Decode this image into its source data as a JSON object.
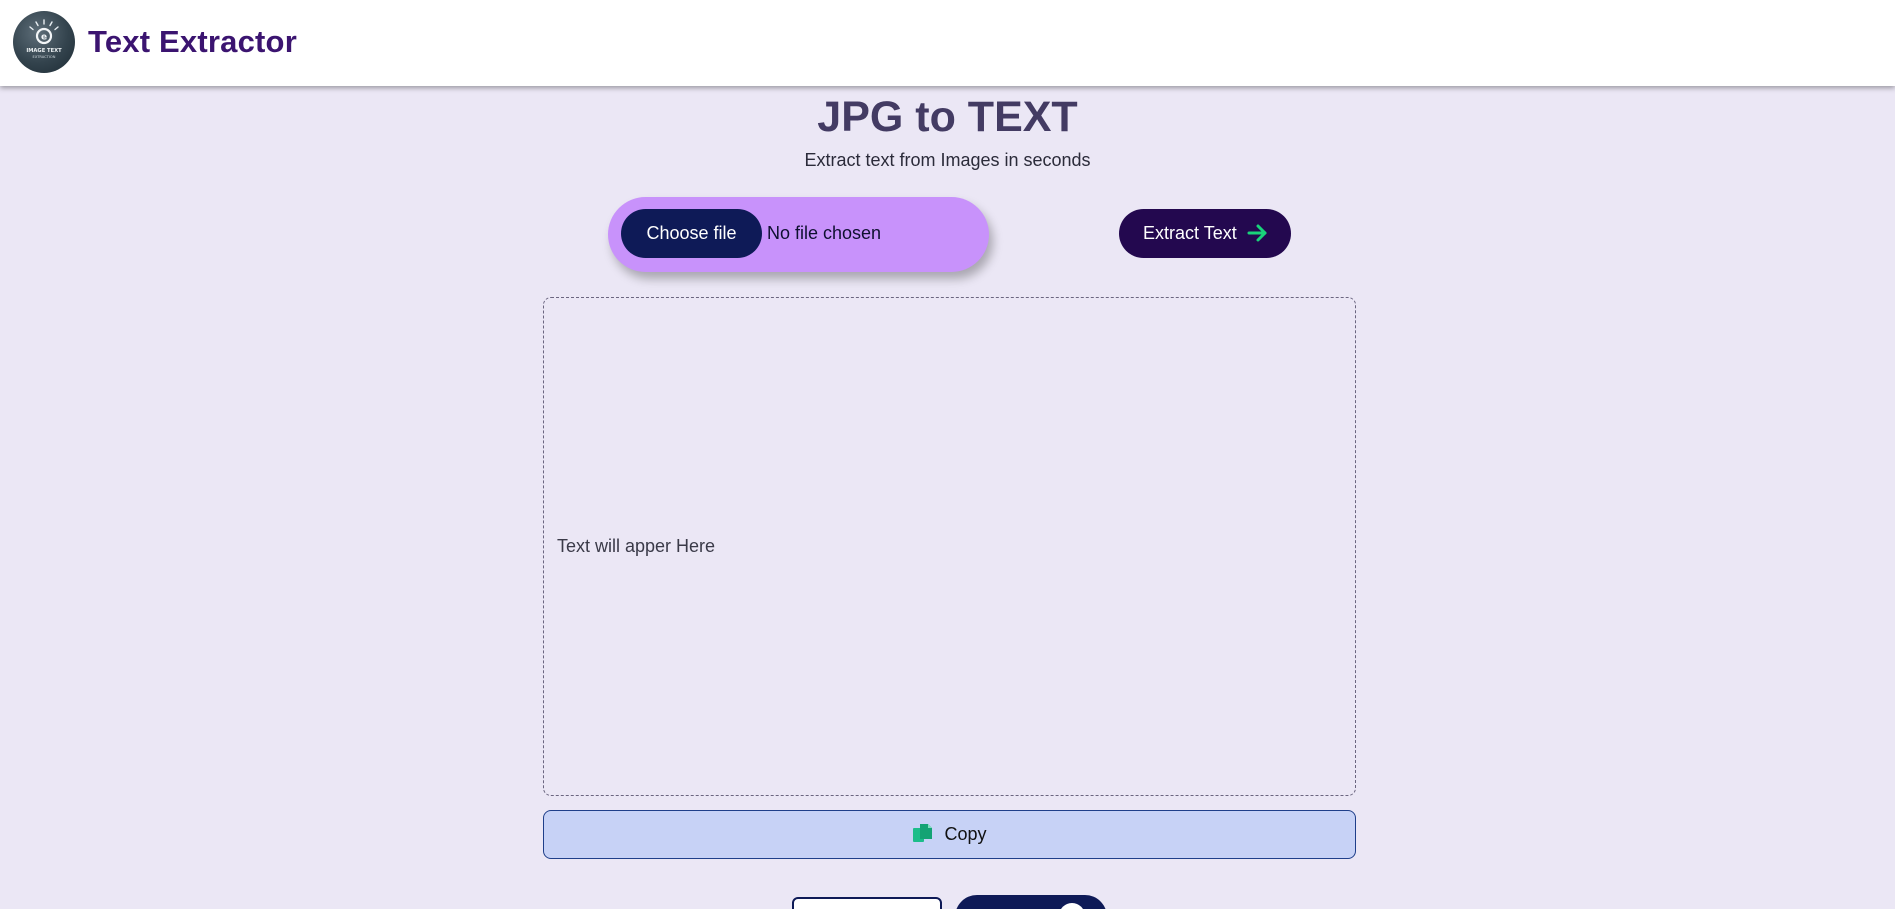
{
  "header": {
    "brand": "Text Extractor",
    "logo_icon": "image-text-extraction-logo"
  },
  "main": {
    "title": "JPG to TEXT",
    "subtitle": "Extract text from Images in seconds",
    "file_input": {
      "button_label": "Choose file",
      "status": "No file chosen"
    },
    "extract_button": {
      "label": "Extract Text",
      "icon": "arrow-right-icon"
    },
    "output": {
      "placeholder": "Text will apper Here"
    },
    "copy_button": {
      "label": "Copy",
      "icon": "copy-icon"
    }
  },
  "colors": {
    "background": "#ebe7f5",
    "brand_text": "#3b1470",
    "file_pill": "#c892fb",
    "choose_button": "#0e1a57",
    "extract_button": "#23084f",
    "arrow_accent": "#19d37a",
    "copy_button": "#c7d2f6",
    "copy_icon": "#1bbd8a"
  }
}
